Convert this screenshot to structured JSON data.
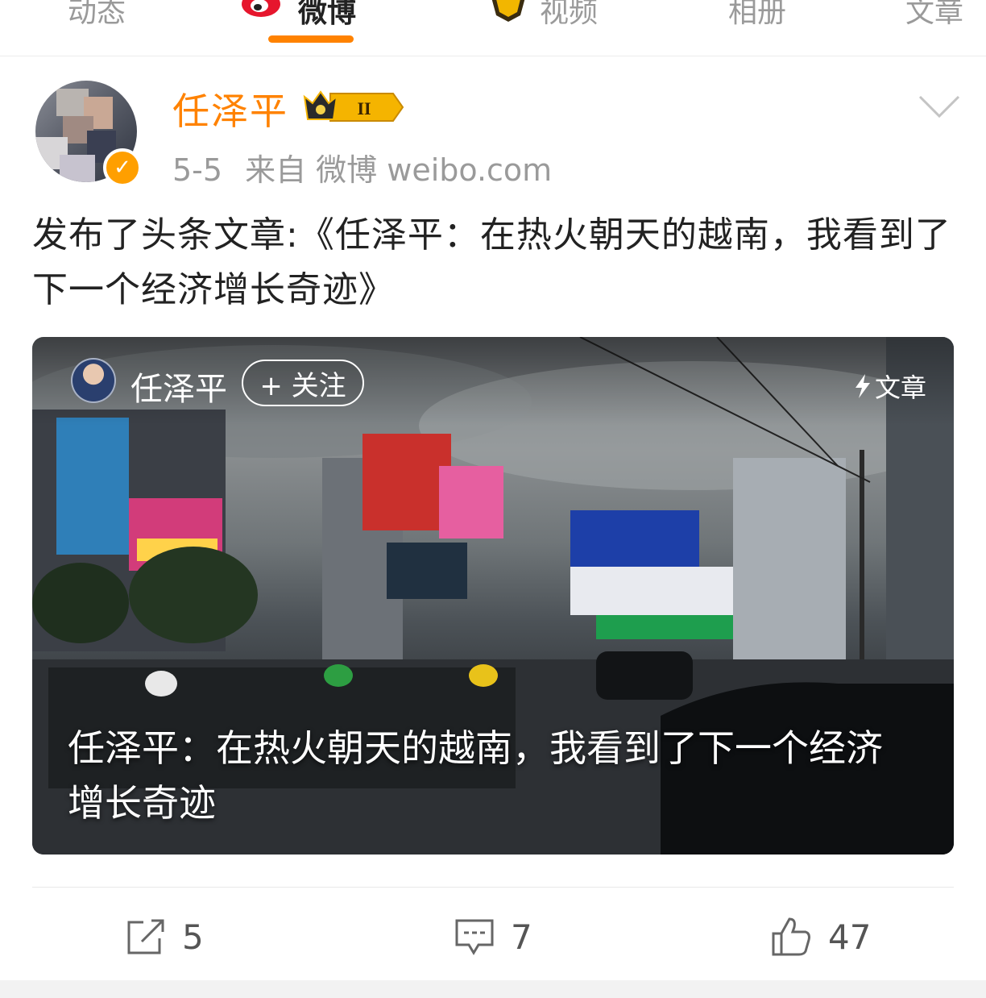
{
  "tabs": [
    {
      "label": "动态"
    },
    {
      "label": "微博",
      "active": true
    },
    {
      "label": "视频"
    },
    {
      "label": "相册"
    },
    {
      "label": "文章"
    }
  ],
  "colors": {
    "accent": "#ff8200",
    "muted": "#9a9a9a",
    "text": "#222222"
  },
  "post": {
    "author": "任泽平",
    "member_level": "II",
    "date": "5-5",
    "source": "来自 微博 weibo.com",
    "text": "发布了头条文章:《任泽平：在热火朝天的越南，我看到了下一个经济增长奇迹》"
  },
  "article_card": {
    "author": "任泽平",
    "follow_label": "+ 关注",
    "tag_label": "文章",
    "title": "任泽平：在热火朝天的越南，我看到了下一个经济增长奇迹"
  },
  "actions": {
    "repost_count": "5",
    "comment_count": "7",
    "like_count": "47"
  },
  "icons": [
    "weibo-logo-icon",
    "video-logo-icon",
    "verified-icon",
    "crown-icon",
    "chevron-down-icon",
    "lightning-icon",
    "repost-icon",
    "comment-icon",
    "like-icon"
  ]
}
